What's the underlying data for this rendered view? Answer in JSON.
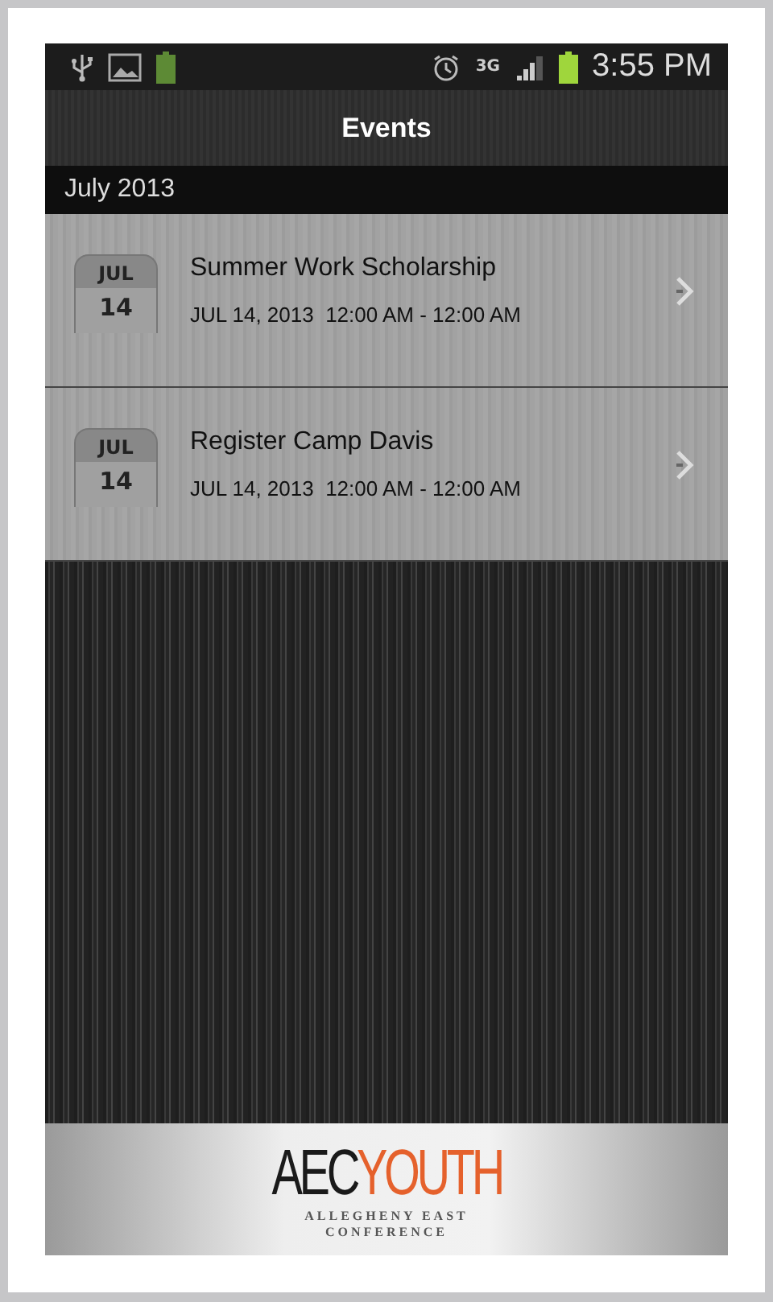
{
  "status_bar": {
    "network": "3G",
    "time": "3:55 PM"
  },
  "title": "Events",
  "section": "July 2013",
  "events": [
    {
      "month": "JUL",
      "day": "14",
      "title": "Summer Work Scholarship",
      "when": "JUL 14, 2013  12:00 AM - 12:00 AM"
    },
    {
      "month": "JUL",
      "day": "14",
      "title": "Register Camp Davis",
      "when": "JUL 14, 2013  12:00 AM - 12:00 AM"
    }
  ],
  "footer": {
    "logo_left": "AEC",
    "logo_right": "YOUTH",
    "subtitle": [
      "ALLEGHENY EAST",
      "CONFERENCE"
    ]
  }
}
